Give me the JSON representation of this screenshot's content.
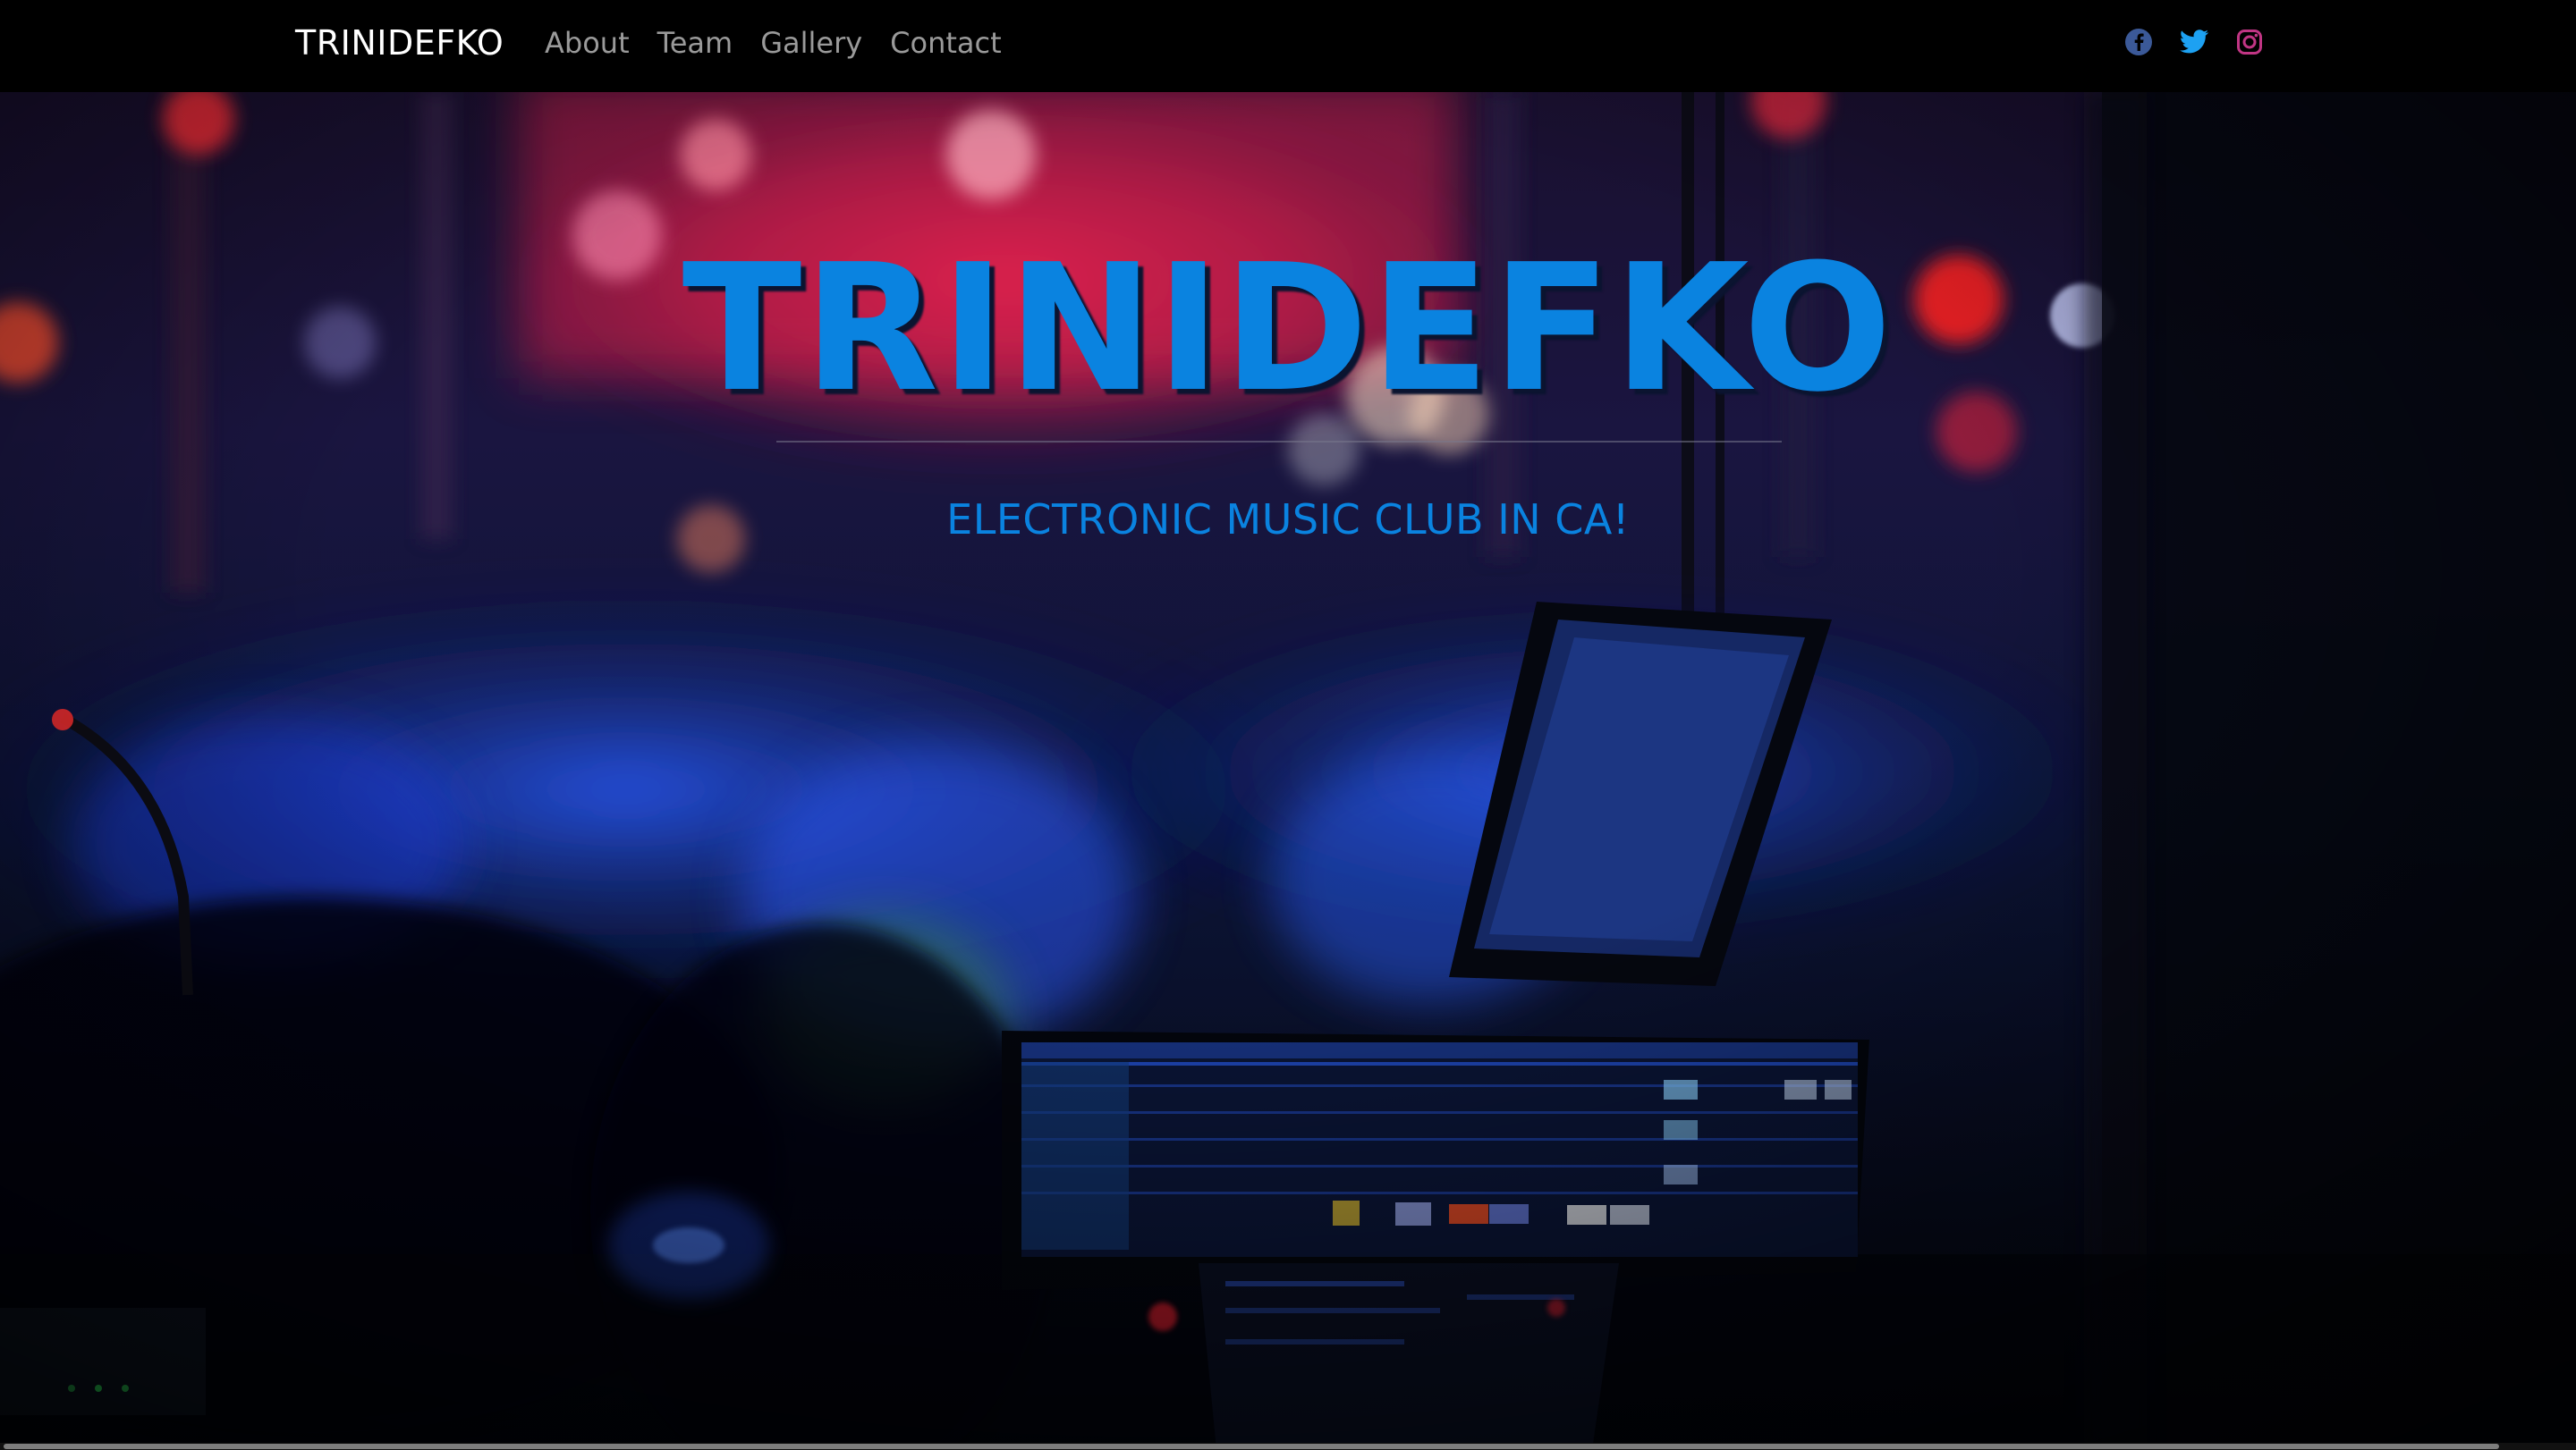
{
  "navbar": {
    "brand": "TRINIDEFKO",
    "links": [
      {
        "label": "About"
      },
      {
        "label": "Team"
      },
      {
        "label": "Gallery"
      },
      {
        "label": "Contact"
      }
    ],
    "social": [
      {
        "icon": "facebook-icon",
        "color": "#3b5998"
      },
      {
        "icon": "twitter-icon",
        "color": "#1da1f2"
      },
      {
        "icon": "instagram-icon",
        "color": "#c13584"
      }
    ]
  },
  "hero": {
    "title": "TRINIDEFKO",
    "subtitle": "ELECTRONIC MUSIC CLUB IN CA!",
    "accent_color": "#0a83e0"
  }
}
